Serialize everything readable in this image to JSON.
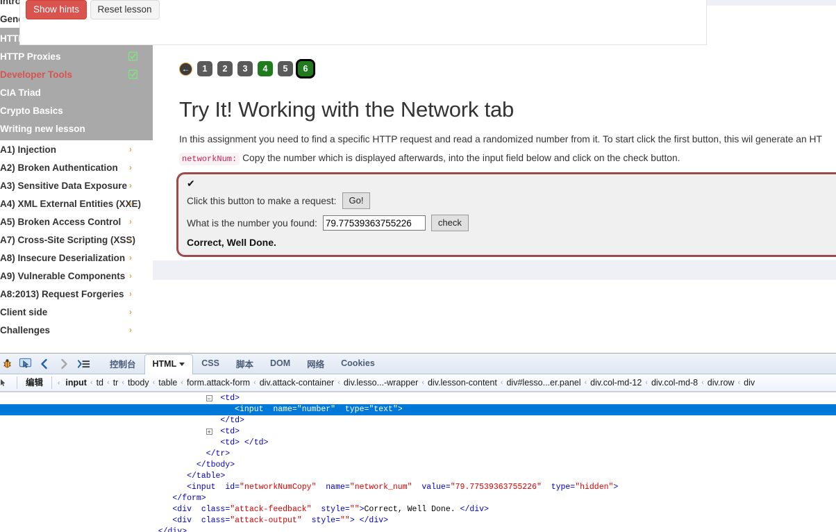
{
  "sidebar": {
    "groups": [
      {
        "label": "Introduction",
        "chevron": "›"
      },
      {
        "label": "General",
        "chevron": "›"
      }
    ],
    "general_items": [
      {
        "label": "HTTP Basics",
        "solved": true,
        "active": false
      },
      {
        "label": "HTTP Proxies",
        "solved": true,
        "active": false
      },
      {
        "label": "Developer Tools",
        "solved": true,
        "active": true
      },
      {
        "label": "CIA Triad",
        "solved": false,
        "active": false
      },
      {
        "label": "Crypto Basics",
        "solved": false,
        "active": false
      },
      {
        "label": "Writing new lesson",
        "solved": false,
        "active": false
      }
    ],
    "categories": [
      {
        "label": "A1) Injection",
        "chevron": "›"
      },
      {
        "label": "A2) Broken Authentication",
        "chevron": "›"
      },
      {
        "label": "A3) Sensitive Data Exposure",
        "chevron": "›"
      },
      {
        "label": "A4) XML External Entities (XXE)",
        "chevron": "›"
      },
      {
        "label": "A5) Broken Access Control",
        "chevron": "›"
      },
      {
        "label": "A7) Cross-Site Scripting (XSS)",
        "chevron": "›"
      },
      {
        "label": "A8) Insecure Deserialization",
        "chevron": "›"
      },
      {
        "label": "A9) Vulnerable Components",
        "chevron": "›"
      },
      {
        "label": "A8:2013) Request Forgeries",
        "chevron": "›"
      },
      {
        "label": "Client side",
        "chevron": "›"
      },
      {
        "label": "Challenges",
        "chevron": "›"
      }
    ]
  },
  "lesson": {
    "show_hints_label": "Show hints",
    "reset_lesson_label": "Reset lesson",
    "title": "Try It! Working with the Network tab",
    "desc_part1": "In this assignment you need to find a specific HTTP request and read a randomized number from it. To start click the first button, this wil generate an HT",
    "code_token": "networkNum:",
    "desc_part2": "Copy the number which is displayed afterwards, into the input field below and click on the check button.",
    "pager": {
      "back_icon": "←",
      "items": [
        {
          "label": "1",
          "solved": false,
          "current": false
        },
        {
          "label": "2",
          "solved": false,
          "current": false
        },
        {
          "label": "3",
          "solved": false,
          "current": false
        },
        {
          "label": "4",
          "solved": true,
          "current": false
        },
        {
          "label": "5",
          "solved": false,
          "current": false
        },
        {
          "label": "6",
          "solved": true,
          "current": true
        }
      ]
    },
    "attack": {
      "tick": "✔",
      "request_label": "Click this button to make a request:",
      "go_label": "Go!",
      "number_label": "What is the number you found:",
      "number_value": "79.77539363755226",
      "check_label": "check",
      "feedback": "Correct, Well Done."
    }
  },
  "devtools": {
    "toolbar_icons": [
      {
        "name": "firebug-icon",
        "glyph": "🐞"
      },
      {
        "name": "inspect-element-icon",
        "glyph": "⬚"
      },
      {
        "name": "back-arrow-icon",
        "glyph": "❮"
      },
      {
        "name": "forward-arrow-icon",
        "glyph": "❯"
      },
      {
        "name": "panel-menu-icon",
        "glyph": "≡"
      }
    ],
    "tabs": [
      {
        "label": "控制台",
        "active": false,
        "caret": false
      },
      {
        "label": "HTML",
        "active": true,
        "caret": true
      },
      {
        "label": "CSS",
        "active": false,
        "caret": false
      },
      {
        "label": "脚本",
        "active": false,
        "caret": false
      },
      {
        "label": "DOM",
        "active": false,
        "caret": false
      },
      {
        "label": "网络",
        "active": false,
        "caret": false
      },
      {
        "label": "Cookies",
        "active": false,
        "caret": false
      }
    ],
    "breadcrumb": {
      "edit_label": "编辑",
      "left_arrow": "‹",
      "separator": "‹",
      "items": [
        {
          "label": "input",
          "current": true
        },
        {
          "label": "td",
          "current": false
        },
        {
          "label": "tr",
          "current": false
        },
        {
          "label": "tbody",
          "current": false
        },
        {
          "label": "table",
          "current": false
        },
        {
          "label": "form.attack-form",
          "current": false
        },
        {
          "label": "div.attack-container",
          "current": false
        },
        {
          "label": "div.lesso...-wrapper",
          "current": false
        },
        {
          "label": "div.lesson-content",
          "current": false
        },
        {
          "label": "div#lesso...er.panel",
          "current": false
        },
        {
          "label": "div.col-md-12",
          "current": false
        },
        {
          "label": "div.col-md-8",
          "current": false
        },
        {
          "label": "div.row",
          "current": false
        },
        {
          "label": "div",
          "current": false
        }
      ]
    },
    "html_lines": [
      {
        "indent": 46,
        "twisty": "−",
        "twisty_indent": 43,
        "selected": false,
        "parts": [
          {
            "t": "tag",
            "s": "<td>"
          }
        ]
      },
      {
        "indent": 49,
        "twisty": null,
        "selected": true,
        "parts": [
          {
            "t": "tag",
            "s": "<input"
          },
          {
            "t": "sp",
            "s": "  "
          },
          {
            "t": "attr",
            "s": "name="
          },
          {
            "t": "val",
            "s": "\"number\""
          },
          {
            "t": "sp",
            "s": "  "
          },
          {
            "t": "attr",
            "s": "type="
          },
          {
            "t": "val",
            "s": "\"text\""
          },
          {
            "t": "tag",
            "s": ">"
          }
        ]
      },
      {
        "indent": 46,
        "twisty": null,
        "selected": false,
        "parts": [
          {
            "t": "tag",
            "s": "</td>"
          }
        ]
      },
      {
        "indent": 46,
        "twisty": "+",
        "twisty_indent": 43,
        "selected": false,
        "parts": [
          {
            "t": "tag",
            "s": "<td>"
          }
        ]
      },
      {
        "indent": 46,
        "twisty": null,
        "selected": false,
        "parts": [
          {
            "t": "tag",
            "s": "<td> </td>"
          }
        ]
      },
      {
        "indent": 43,
        "twisty": null,
        "selected": false,
        "parts": [
          {
            "t": "tag",
            "s": "</tr>"
          }
        ]
      },
      {
        "indent": 41,
        "twisty": null,
        "selected": false,
        "parts": [
          {
            "t": "tag",
            "s": "</tbody>"
          }
        ]
      },
      {
        "indent": 39,
        "twisty": null,
        "selected": false,
        "parts": [
          {
            "t": "tag",
            "s": "</table>"
          }
        ]
      },
      {
        "indent": 39,
        "twisty": null,
        "selected": false,
        "parts": [
          {
            "t": "tag",
            "s": "<input"
          },
          {
            "t": "sp",
            "s": "  "
          },
          {
            "t": "attr",
            "s": "id="
          },
          {
            "t": "val",
            "s": "\"networkNumCopy\""
          },
          {
            "t": "sp",
            "s": "  "
          },
          {
            "t": "attr",
            "s": "name="
          },
          {
            "t": "val",
            "s": "\"network_num\""
          },
          {
            "t": "sp",
            "s": "  "
          },
          {
            "t": "attr",
            "s": "value="
          },
          {
            "t": "val",
            "s": "\"79.77539363755226\""
          },
          {
            "t": "sp",
            "s": "  "
          },
          {
            "t": "attr",
            "s": "type="
          },
          {
            "t": "val",
            "s": "\"hidden\""
          },
          {
            "t": "tag",
            "s": ">"
          }
        ]
      },
      {
        "indent": 36,
        "twisty": null,
        "selected": false,
        "parts": [
          {
            "t": "tag",
            "s": "</form>"
          }
        ]
      },
      {
        "indent": 36,
        "twisty": null,
        "selected": false,
        "parts": [
          {
            "t": "tag",
            "s": "<div"
          },
          {
            "t": "sp",
            "s": "  "
          },
          {
            "t": "attr",
            "s": "class="
          },
          {
            "t": "val",
            "s": "\"attack-feedback\""
          },
          {
            "t": "sp",
            "s": "  "
          },
          {
            "t": "attr",
            "s": "style="
          },
          {
            "t": "val",
            "s": "\"\""
          },
          {
            "t": "tag",
            "s": ">"
          },
          {
            "t": "text",
            "s": "Correct, Well Done."
          },
          {
            "t": "tag",
            "s": " </div>"
          }
        ]
      },
      {
        "indent": 36,
        "twisty": null,
        "selected": false,
        "parts": [
          {
            "t": "tag",
            "s": "<div"
          },
          {
            "t": "sp",
            "s": "  "
          },
          {
            "t": "attr",
            "s": "class="
          },
          {
            "t": "val",
            "s": "\"attack-output\""
          },
          {
            "t": "sp",
            "s": "  "
          },
          {
            "t": "attr",
            "s": "style="
          },
          {
            "t": "val",
            "s": "\"\""
          },
          {
            "t": "tag",
            "s": "> </div>"
          }
        ]
      },
      {
        "indent": 33,
        "twisty": null,
        "selected": false,
        "parts": [
          {
            "t": "tag",
            "s": "</div>"
          }
        ]
      }
    ]
  }
}
